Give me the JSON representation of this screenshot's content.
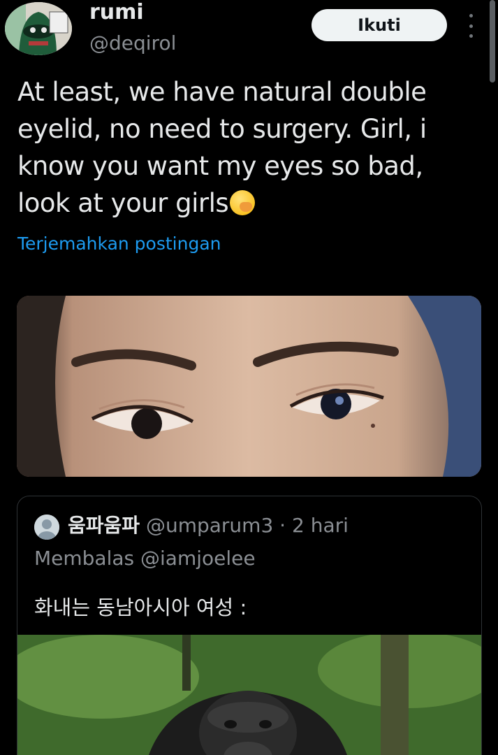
{
  "author": {
    "display_name": "rumi",
    "handle": "@deqirol"
  },
  "header": {
    "follow_label": "Ikuti",
    "more_icon": "more-vertical-icon"
  },
  "tweet": {
    "text": "At least, we have natural double eyelid, no need to surgery. Girl, i know you want my eyes so bad, look at your girls",
    "emoji": "🤭",
    "translate_label": "Terjemahkan postingan"
  },
  "quoted_tweet": {
    "display_name": "움파움파",
    "handle": "@umparum3",
    "separator": "·",
    "time": "2 hari",
    "reply_to": "Membalas @iamjoelee",
    "text": "화내는 동남아시아 여성 :"
  },
  "colors": {
    "background": "#000000",
    "text": "#e7e9ea",
    "muted": "#8b8f94",
    "link": "#1d9bf0",
    "follow_bg": "#eff3f4",
    "border": "#2f3336"
  }
}
